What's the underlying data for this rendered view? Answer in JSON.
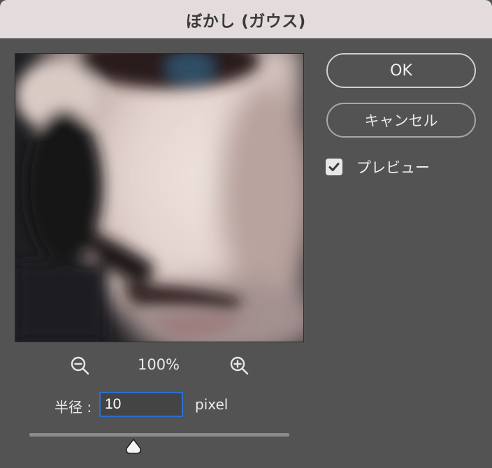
{
  "dialog": {
    "title": "ぼかし (ガウス)"
  },
  "buttons": {
    "ok_label": "OK",
    "cancel_label": "キャンセル"
  },
  "preview_toggle": {
    "label": "プレビュー",
    "checked": true
  },
  "zoom": {
    "level": "100%",
    "zoom_out_icon": "zoom-out-icon",
    "zoom_in_icon": "zoom-in-icon"
  },
  "radius": {
    "label": "半径 :",
    "value": "10",
    "unit": "pixel",
    "slider_fraction": 0.4
  },
  "colors": {
    "dialog_bg": "#535353",
    "titlebar_bg": "#e4dcdc",
    "focus_ring": "#2d6fce"
  },
  "preview_image": {
    "description_icon": "blurred-face-preview"
  }
}
